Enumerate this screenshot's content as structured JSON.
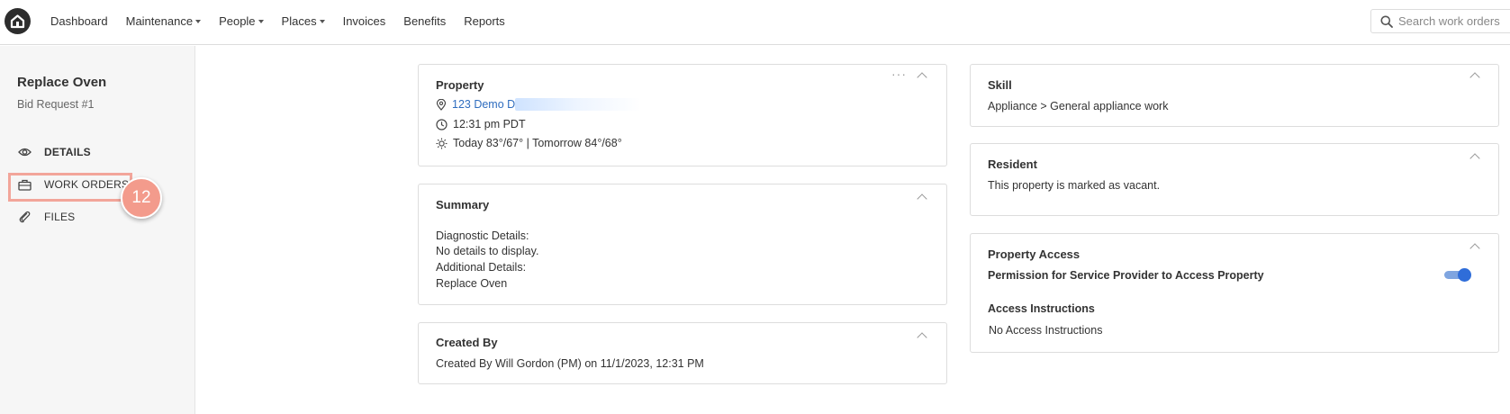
{
  "nav": {
    "items": [
      "Dashboard",
      "Maintenance",
      "People",
      "Places",
      "Invoices",
      "Benefits",
      "Reports"
    ],
    "dropdowns": [
      false,
      true,
      true,
      true,
      false,
      false,
      false
    ],
    "search_placeholder": "Search work orders"
  },
  "sidebar": {
    "title": "Replace Oven",
    "subtitle": "Bid Request #1",
    "items": [
      {
        "label": "DETAILS",
        "icon": "eye-icon"
      },
      {
        "label": "WORK ORDERS",
        "icon": "briefcase-icon"
      },
      {
        "label": "FILES",
        "icon": "paperclip-icon"
      }
    ],
    "step_badge": "12"
  },
  "property": {
    "title": "Property",
    "address": "123 Demo D",
    "time": "12:31 pm PDT",
    "weather": "Today 83°/67° | Tomorrow 84°/68°"
  },
  "summary": {
    "title": "Summary",
    "lines": [
      "Diagnostic Details:",
      "No details to display.",
      "Additional Details:",
      "Replace Oven"
    ]
  },
  "created": {
    "title": "Created By",
    "text": "Created By Will Gordon (PM) on 11/1/2023, 12:31 PM"
  },
  "skill": {
    "title": "Skill",
    "text": "Appliance > General appliance work"
  },
  "resident": {
    "title": "Resident",
    "text": "This property is marked as vacant."
  },
  "access": {
    "title": "Property Access",
    "permission_label": "Permission for Service Provider to Access Property",
    "permission_enabled": true,
    "instructions_title": "Access Instructions",
    "instructions_text": "No Access Instructions"
  },
  "colors": {
    "link": "#2f6dbf",
    "toggle": "#2f6dd9",
    "highlight": "#f2a59a",
    "badge": "#f39b8c"
  }
}
